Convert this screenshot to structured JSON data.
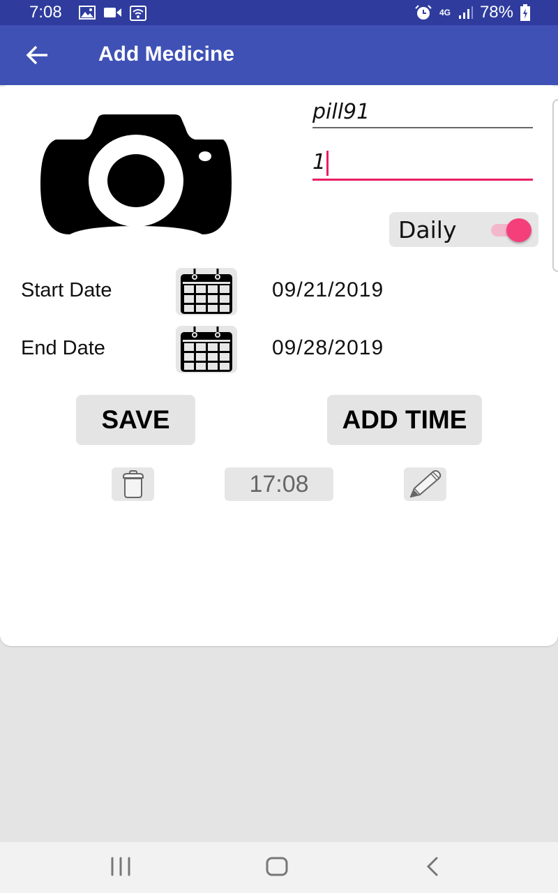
{
  "status_bar": {
    "time": "7:08",
    "left_icons": [
      "image-icon",
      "video-icon",
      "wifi-icon"
    ],
    "right_icons": [
      "alarm-icon",
      "4g-icon",
      "signal-icon",
      "battery-charging-icon"
    ],
    "network": "4G",
    "battery": "78%"
  },
  "app_bar": {
    "title": "Add Medicine",
    "back_icon": "arrow-back-icon"
  },
  "form": {
    "photo_icon": "camera-icon",
    "name_value": "pill91",
    "dose_value": "1",
    "daily_label": "Daily",
    "daily_on": true,
    "start_date_label": "Start Date",
    "start_date": "09/21/2019",
    "end_date_label": "End Date",
    "end_date": "09/28/2019",
    "calendar_icon": "calendar-icon"
  },
  "actions": {
    "save_label": "SAVE",
    "add_time_label": "ADD TIME"
  },
  "times": [
    {
      "time": "17:08",
      "delete_icon": "trash-icon",
      "edit_icon": "pencil-icon"
    }
  ],
  "colors": {
    "status_bar": "#2f3c9e",
    "app_bar": "#3f51b5",
    "accent": "#e91e63",
    "switch_thumb": "#f43f7b",
    "button_bg": "#e4e4e4",
    "background": "#e4e4e4"
  },
  "nav_bar": {
    "items": [
      "recents-icon",
      "home-icon",
      "back-icon"
    ]
  }
}
